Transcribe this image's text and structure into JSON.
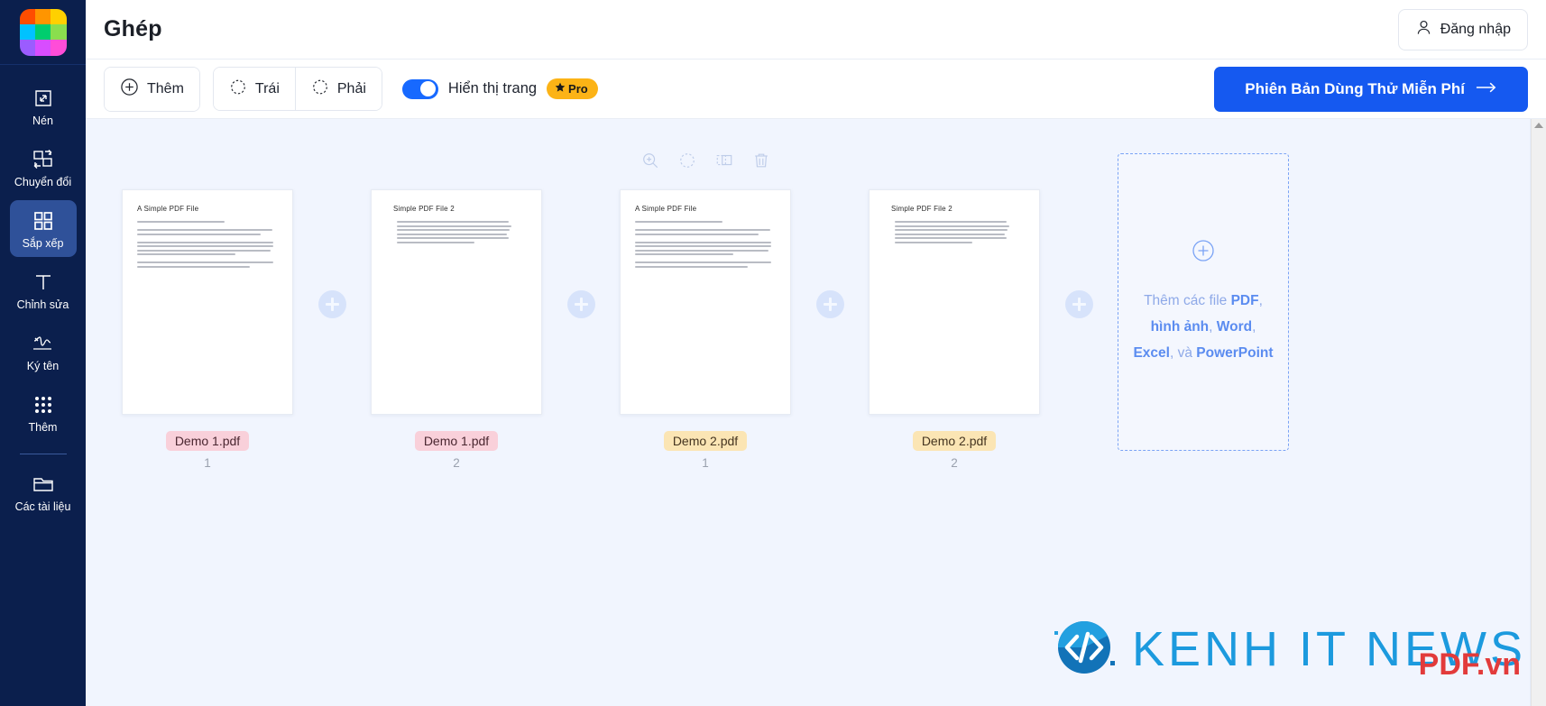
{
  "sidebar": {
    "logo": {
      "name": "app-logo",
      "colors": [
        "#ff4d00",
        "#ff9500",
        "#ffd000",
        "#00c2ff",
        "#00cd6e",
        "#8ade4e",
        "#9b5cff",
        "#d84dff",
        "#ff4dd8"
      ]
    },
    "items": [
      {
        "label": "Nén",
        "icon": "compress-icon",
        "active": false
      },
      {
        "label": "Chuyển đổi",
        "icon": "convert-icon",
        "active": false
      },
      {
        "label": "Sắp xếp",
        "icon": "grid-icon",
        "active": true
      },
      {
        "label": "Chỉnh sửa",
        "icon": "text-edit-icon",
        "active": false
      },
      {
        "label": "Ký tên",
        "icon": "signature-icon",
        "active": false
      },
      {
        "label": "Thêm",
        "icon": "dots-grid-icon",
        "active": false
      },
      {
        "label": "Các tài liệu",
        "icon": "folder-icon",
        "active": false
      }
    ]
  },
  "header": {
    "title": "Ghép",
    "login_label": "Đăng nhập"
  },
  "toolbar": {
    "add_label": "Thêm",
    "rotate_left_label": "Trái",
    "rotate_right_label": "Phải",
    "toggle_label": "Hiển thị trang",
    "toggle_on": true,
    "pro_badge": "Pro",
    "cta_label": "Phiên Bản Dùng Thử Miễn Phí",
    "cta_arrow": "→"
  },
  "hover_tools": [
    {
      "name": "zoom-in-icon"
    },
    {
      "name": "rotate-icon"
    },
    {
      "name": "duplicate-icon"
    },
    {
      "name": "delete-icon"
    }
  ],
  "pages": [
    {
      "doc_title": "A Simple PDF File",
      "file_label": "Demo 1.pdf",
      "page_number": "1",
      "badge_bg": "#f9d0da",
      "badge_color": "#4a2630",
      "variant": "long"
    },
    {
      "doc_title": "Simple PDF File 2",
      "file_label": "Demo 1.pdf",
      "page_number": "2",
      "badge_bg": "#f9d0da",
      "badge_color": "#4a2630",
      "variant": "short"
    },
    {
      "doc_title": "A Simple PDF File",
      "file_label": "Demo 2.pdf",
      "page_number": "1",
      "badge_bg": "#fbe5b4",
      "badge_color": "#453520",
      "variant": "long"
    },
    {
      "doc_title": "Simple PDF File 2",
      "file_label": "Demo 2.pdf",
      "page_number": "2",
      "badge_bg": "#fbe5b4",
      "badge_color": "#453520",
      "variant": "short"
    }
  ],
  "dropzone": {
    "prefix": "Thêm các file ",
    "pdf": "PDF",
    "sep1": ", ",
    "image": "hình ảnh",
    "sep2": ", ",
    "word": "Word",
    "sep3": ", ",
    "excel": "Excel",
    "sep4": ", và ",
    "powerpoint": "PowerPoint"
  },
  "watermark": {
    "text": "KENH IT NEWS",
    "overlay": "PDF.vn"
  },
  "theme": {
    "sidebar_bg": "#0b1f4d",
    "sidebar_active": "#2f5199",
    "accent_blue": "#1559f0",
    "canvas_bg": "#f1f5fe",
    "pro_yellow": "#fcb316"
  }
}
